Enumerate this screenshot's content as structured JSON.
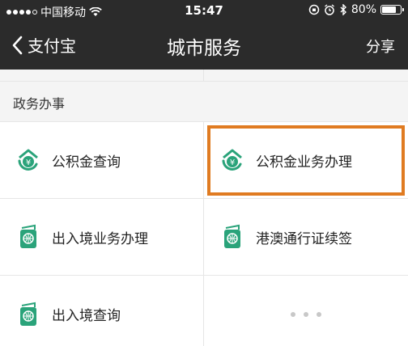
{
  "status_bar": {
    "carrier": "中国移动",
    "time": "15:47",
    "battery_percent": "80%",
    "battery_level": 0.8,
    "signal_bars_filled": 4,
    "signal_bars_total": 5
  },
  "nav": {
    "back_label": "支付宝",
    "title": "城市服务",
    "share_label": "分享"
  },
  "section": {
    "title": "政务办事"
  },
  "services": [
    {
      "label": "公积金查询",
      "icon": "fund-icon"
    },
    {
      "label": "公积金业务办理",
      "icon": "fund-icon",
      "highlighted": true
    },
    {
      "label": "出入境业务办理",
      "icon": "passport-icon"
    },
    {
      "label": "港澳通行证续签",
      "icon": "passport-icon"
    },
    {
      "label": "出入境查询",
      "icon": "passport-icon"
    }
  ],
  "colors": {
    "nav_background": "#2b2b2b",
    "icon_green": "#2aa37a",
    "highlight_orange": "#e07b21",
    "page_background": "#f4f4f4"
  }
}
